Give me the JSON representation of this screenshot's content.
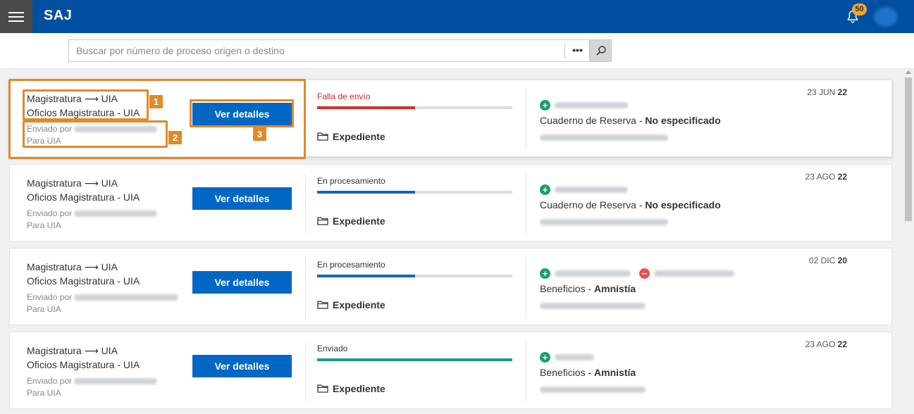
{
  "header": {
    "app_title": "SAJ",
    "notification_count": "50"
  },
  "search": {
    "placeholder": "Buscar por número de proceso origen o destino",
    "more_label": "•••"
  },
  "annotations": [
    "1",
    "2",
    "3"
  ],
  "cards": [
    {
      "route": "Magistratura ⟶ UIA",
      "title": "Oficios Magistratura - UIA",
      "sent_by_label": "Enviado por",
      "to_label": "Para UIA",
      "button_label": "Ver detalles",
      "status": "Falla de envío",
      "status_color": "#d32f2f",
      "progress": 0.5,
      "expediente_label": "Expediente",
      "category": "Cuaderno de Reserva - ",
      "category_value": "No especificado",
      "date_prefix": "23 JUN ",
      "date_year": "22"
    },
    {
      "route": "Magistratura ⟶ UIA",
      "title": "Oficios Magistratura - UIA",
      "sent_by_label": "Enviado por",
      "to_label": "Para UIA",
      "button_label": "Ver detalles",
      "status": "En procesamiento",
      "status_color": "#1565c0",
      "progress": 0.5,
      "expediente_label": "Expediente",
      "category": "Cuaderno de Reserva - ",
      "category_value": "No especificado",
      "date_prefix": "23 AGO ",
      "date_year": "22"
    },
    {
      "route": "Magistratura ⟶ UIA",
      "title": "Oficios Magistratura - UIA",
      "sent_by_label": "Enviado por",
      "to_label": "Para UIA",
      "button_label": "Ver detalles",
      "status": "En procesamiento",
      "status_color": "#1565c0",
      "progress": 0.5,
      "expediente_label": "Expediente",
      "category": "Beneficios - ",
      "category_value": "Amnistía",
      "date_prefix": "02 DIC ",
      "date_year": "20"
    },
    {
      "route": "Magistratura ⟶ UIA",
      "title": "Oficios Magistratura - UIA",
      "sent_by_label": "Enviado por",
      "to_label": "Para UIA",
      "button_label": "Ver detalles",
      "status": "Enviado",
      "status_color": "#1a9e7a",
      "progress": 1.0,
      "expediente_label": "Expediente",
      "category": "Beneficios - ",
      "category_value": "Amnistía",
      "date_prefix": "23 AGO ",
      "date_year": "22"
    }
  ]
}
